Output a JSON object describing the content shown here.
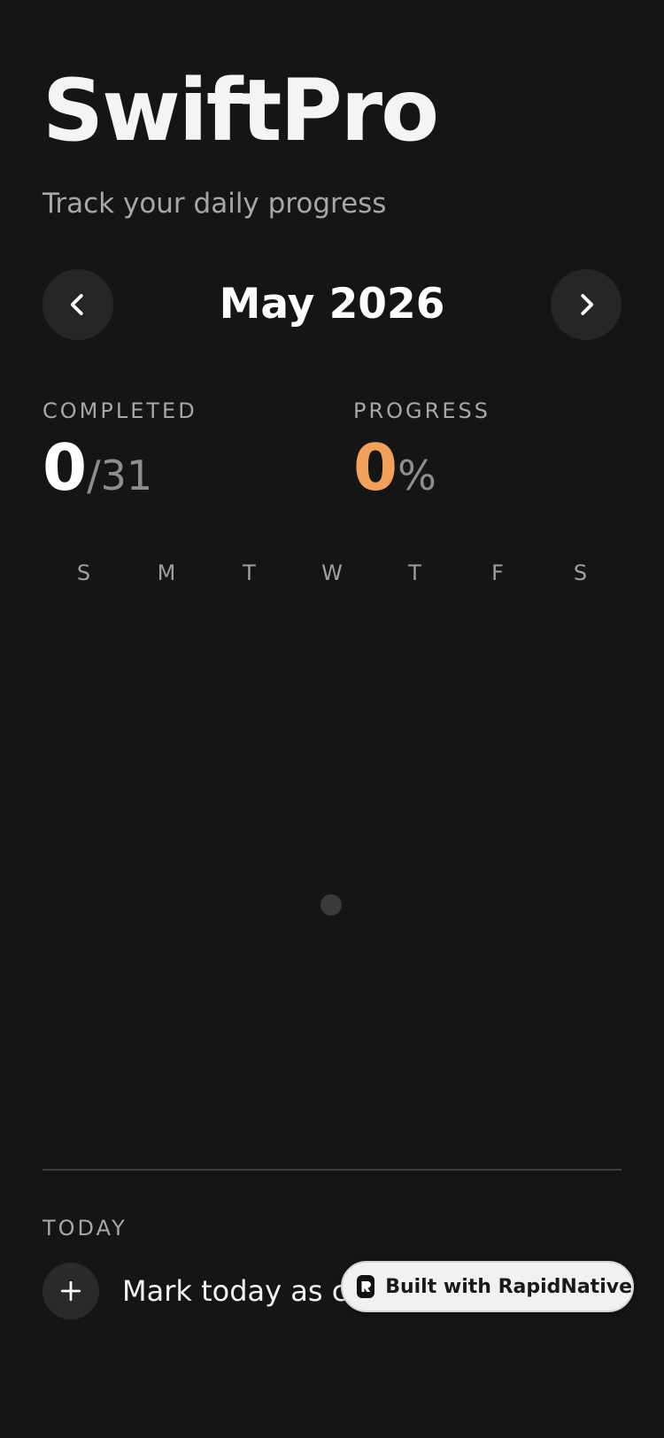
{
  "app": {
    "title": "SwiftPro",
    "subtitle": "Track your daily progress"
  },
  "calendar": {
    "month_label": "May 2026",
    "weekdays": [
      "S",
      "M",
      "T",
      "W",
      "T",
      "F",
      "S"
    ]
  },
  "stats": {
    "completed_label": "COMPLETED",
    "completed_value": "0",
    "completed_total": "/31",
    "progress_label": "PROGRESS",
    "progress_value": "0",
    "progress_unit": "%"
  },
  "today": {
    "label": "TODAY",
    "action_text": "Mark today as completed"
  },
  "badge": {
    "text": "Built with RapidNative"
  },
  "colors": {
    "background": "#161515",
    "accent": "#f2a15a",
    "muted_text": "#a7a7a7"
  },
  "icons": {
    "prev": "chevron-left-icon",
    "next": "chevron-right-icon",
    "add": "plus-icon",
    "badge_logo": "rapidnative-logo-icon"
  }
}
